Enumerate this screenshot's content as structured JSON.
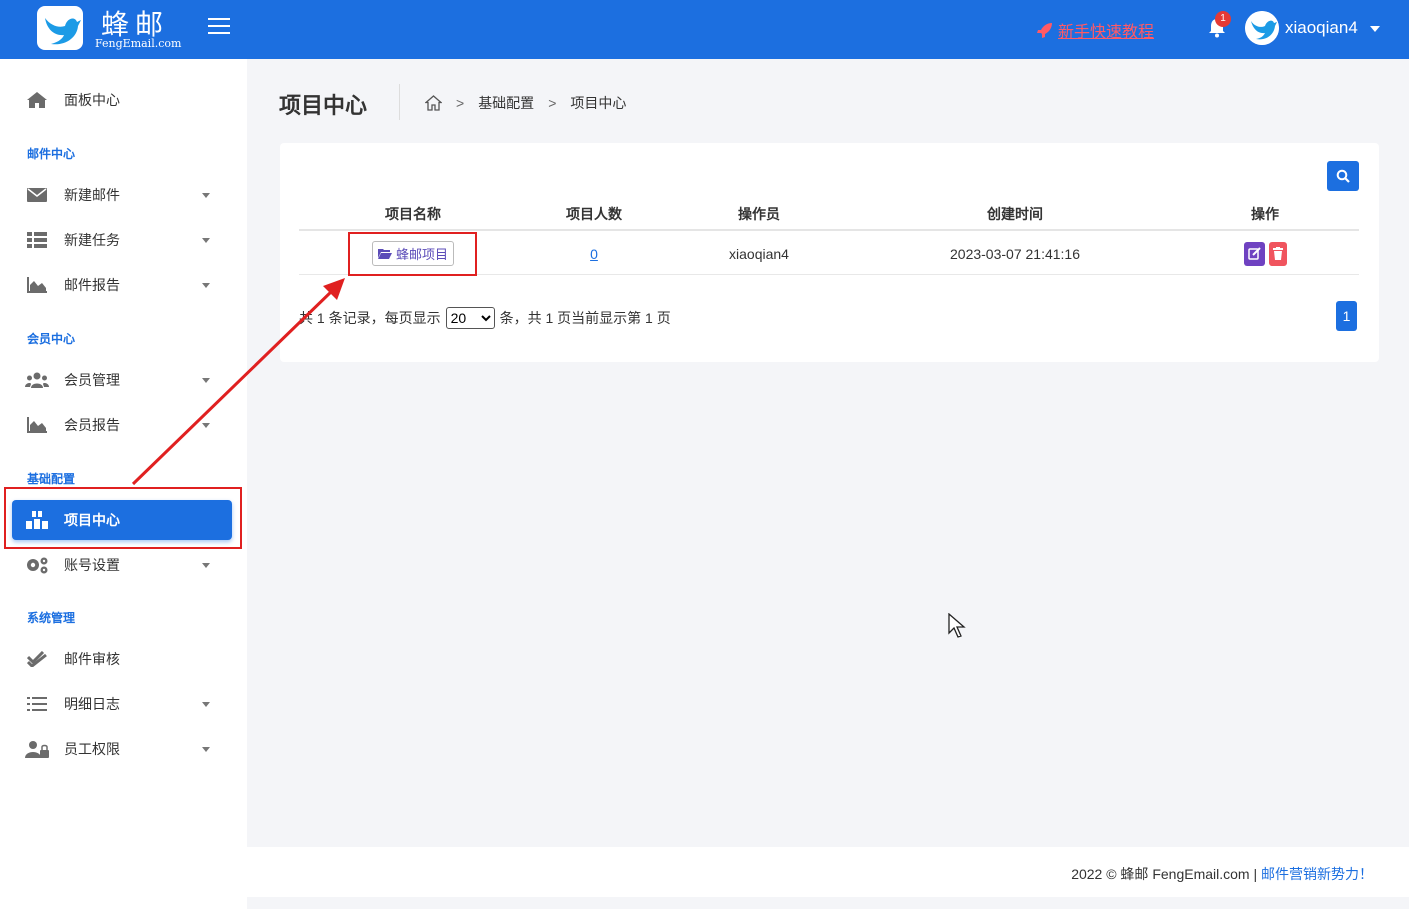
{
  "header": {
    "logo_title": "蜂邮",
    "logo_subtitle": "FengEmail.com",
    "tutorial_label": "新手快速教程",
    "notification_count": "1",
    "username": "xiaoqian4",
    "brand_color": "#1c6fe0"
  },
  "sidebar": {
    "dashboard": "面板中心",
    "groups": {
      "mail": "邮件中心",
      "member": "会员中心",
      "basic": "基础配置",
      "system": "系统管理"
    },
    "items": {
      "new_mail": "新建邮件",
      "new_task": "新建任务",
      "mail_report": "邮件报告",
      "member_manage": "会员管理",
      "member_report": "会员报告",
      "project_center": "项目中心",
      "account_settings": "账号设置",
      "mail_review": "邮件审核",
      "detail_log": "明细日志",
      "staff_permission": "员工权限"
    }
  },
  "page": {
    "title": "项目中心",
    "breadcrumb": [
      "基础配置",
      "项目中心"
    ]
  },
  "table": {
    "columns": [
      "项目名称",
      "项目人数",
      "操作员",
      "创建时间",
      "操作"
    ],
    "rows": [
      {
        "name": "蜂邮项目",
        "count": "0",
        "operator": "xiaoqian4",
        "created": "2023-03-07 21:41:16"
      }
    ]
  },
  "pager": {
    "text_a": "共 1 条记录，每页显示",
    "page_size": "20",
    "text_b": "条，共 1 页当前显示第 1 页",
    "current_page": "1"
  },
  "footer": {
    "copyright": "2022 © 蜂邮 FengEmail.com |",
    "slogan": "邮件营销新势力！"
  }
}
